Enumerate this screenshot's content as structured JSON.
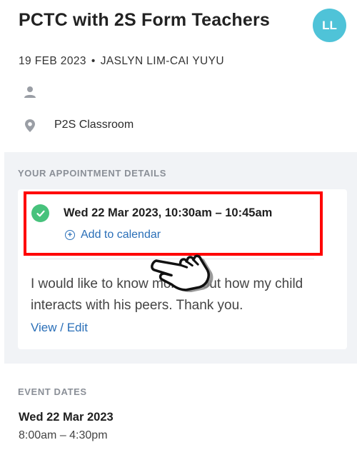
{
  "event": {
    "title": "PCTC with 2S Form Teachers",
    "date": "19 FEB 2023",
    "separator": "•",
    "organizer": "JASLYN LIM-CAI YUYU",
    "location": "P2S Classroom"
  },
  "avatar": {
    "initials": "LL",
    "color": "#4fc3d8"
  },
  "appointment": {
    "heading": "YOUR APPOINTMENT DETAILS",
    "time": "Wed 22 Mar 2023, 10:30am – 10:45am",
    "add_to_calendar": "Add to calendar",
    "message_line1": "I would like to know more about how my child",
    "message_line2": "interacts with his peers. Thank you.",
    "view_edit": "View / Edit",
    "status_color": "#47c27c"
  },
  "event_dates": {
    "heading": "EVENT DATES",
    "date": "Wed 22 Mar 2023",
    "time_range": "8:00am – 4:30pm"
  },
  "icons": [
    "person-icon",
    "location-pin-icon",
    "check-circle-icon",
    "add-circle-icon",
    "pointing-hand-icon"
  ],
  "colors": {
    "link": "#2a6fb8",
    "highlight": "#ff0000"
  }
}
